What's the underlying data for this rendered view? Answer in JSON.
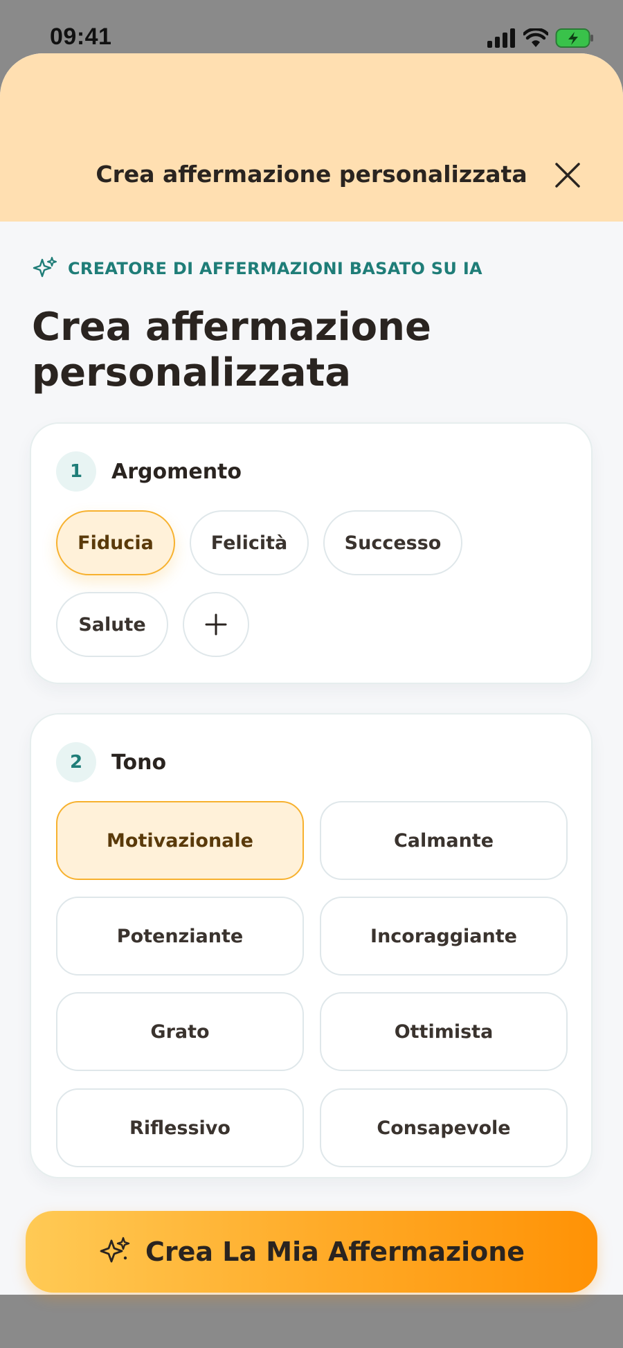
{
  "status_bar": {
    "time": "09:41"
  },
  "sheet": {
    "title": "Crea affermazione personalizzata",
    "close_icon": "close-icon"
  },
  "intro": {
    "eyebrow": "CREATORE DI AFFERMAZIONI BASATO SU IA",
    "heading": "Crea affermazione personalizzata"
  },
  "topic": {
    "step": "1",
    "label": "Argomento",
    "chips": [
      "Fiducia",
      "Felicità",
      "Successo",
      "Salute"
    ],
    "selected": "Fiducia"
  },
  "tone": {
    "step": "2",
    "label": "Tono",
    "options": [
      "Motivazionale",
      "Calmante",
      "Potenziante",
      "Incoraggiante",
      "Grato",
      "Ottimista",
      "Riflessivo",
      "Consapevole"
    ],
    "selected": "Motivazionale"
  },
  "cta": {
    "label": "Crea La Mia Affermazione",
    "icon": "sparkles-icon"
  },
  "colors": {
    "accent": "#f7b12e",
    "header": "#ffdfb1",
    "teal": "#1f7d78"
  }
}
